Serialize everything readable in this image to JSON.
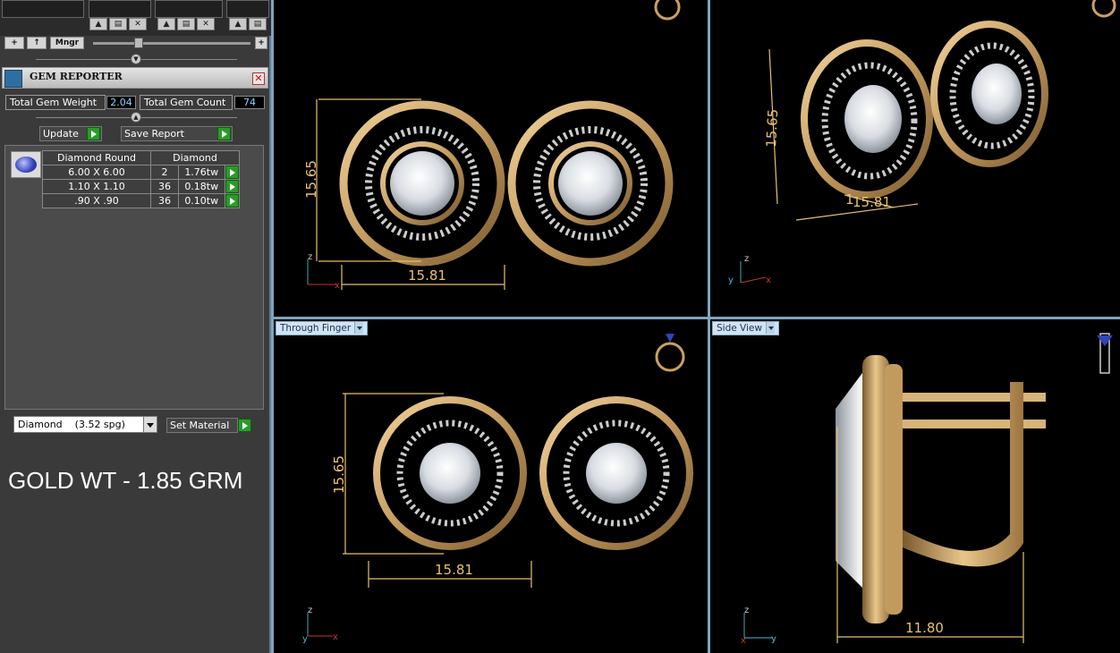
{
  "toolbar": {
    "add_label": "+",
    "up_label": "↑",
    "manager_label": "Mngr",
    "zoom_in_label": "+"
  },
  "gem_reporter": {
    "title": "GEM REPORTER",
    "total_weight_label": "Total Gem Weight",
    "total_weight_value": "2.04",
    "total_count_label": "Total Gem Count",
    "total_count_value": "74",
    "update_label": "Update",
    "save_report_label": "Save Report",
    "table": {
      "headers": [
        "Diamond Round",
        "Diamond"
      ],
      "rows": [
        {
          "size": "6.00 X 6.00",
          "count": "2",
          "weight": "1.76tw"
        },
        {
          "size": "1.10 X 1.10",
          "count": "36",
          "weight": "0.18tw"
        },
        {
          "size": ".90 X .90",
          "count": "36",
          "weight": "0.10tw"
        }
      ]
    },
    "material_select": "Diamond    (3.52 spg)",
    "set_material_label": "Set Material"
  },
  "gold_weight": "GOLD WT - 1.85 GRM",
  "viewports": {
    "top_left": {
      "dim_width": "15.81",
      "dim_height": "15.65",
      "axis_z": "z",
      "axis_x": "x"
    },
    "top_right": {
      "dim_width": "15.81",
      "dim_height": "15.65",
      "dim_small": "1",
      "axis_z": "z",
      "axis_y": "y",
      "axis_x": "x"
    },
    "bottom_left": {
      "label": "Through Finger",
      "dim_width": "15.81",
      "dim_height": "15.65",
      "axis_z": "z",
      "axis_y": "y",
      "axis_x": "x"
    },
    "bottom_right": {
      "label": "Side View",
      "dim_width": "11.80",
      "axis_z": "z",
      "axis_x": "x",
      "axis_y": "y"
    }
  },
  "colors": {
    "gold": "#c9a061",
    "dimension": "#e8c070",
    "viewport_bg": "#000000",
    "accent_green": "#2a9a2a"
  }
}
